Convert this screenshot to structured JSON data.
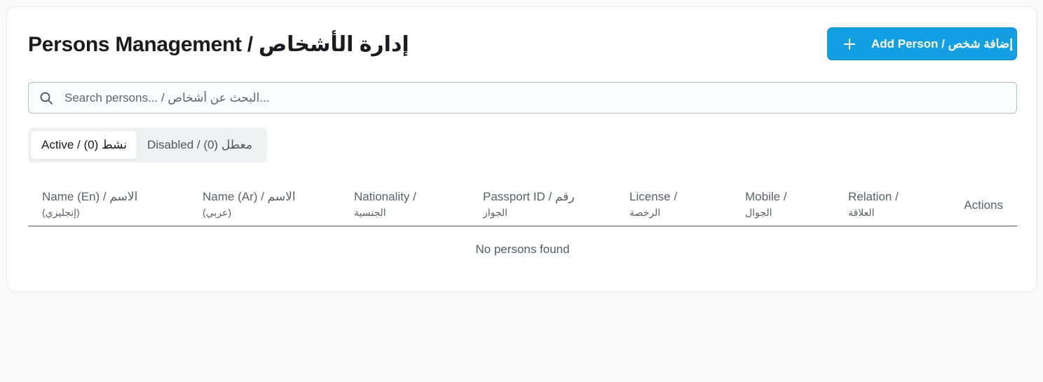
{
  "page": {
    "title": "Persons Management / إدارة الأشخاص",
    "add_button_label": "Add Person / إضافة شخص"
  },
  "search": {
    "placeholder": "Search persons... / البحث عن أشخاص...",
    "value": ""
  },
  "tabs": [
    {
      "label": "Active / (0) نشط",
      "active": true
    },
    {
      "label": "Disabled / (0) معطل",
      "active": false
    }
  ],
  "table": {
    "columns": [
      {
        "line1": "Name (En) / الاسم",
        "line2": "(إنجليزي)"
      },
      {
        "line1": "Name (Ar) / الاسم",
        "line2": "(عربي)"
      },
      {
        "line1": "Nationality /",
        "line2": "الجنسية"
      },
      {
        "line1": "Passport ID / رقم",
        "line2": "الجواز"
      },
      {
        "line1": "License /",
        "line2": "الرخصة"
      },
      {
        "line1": "Mobile /",
        "line2": "الجوال"
      },
      {
        "line1": "Relation /",
        "line2": "العلاقة"
      },
      {
        "line1": "Actions",
        "line2": ""
      }
    ],
    "rows": [],
    "empty_text": "No persons found"
  },
  "colors": {
    "accent": "#139fe2",
    "background": "#fafafa",
    "card": "#ffffff"
  },
  "icons": {
    "search": "search-icon",
    "add": "plus-icon"
  }
}
